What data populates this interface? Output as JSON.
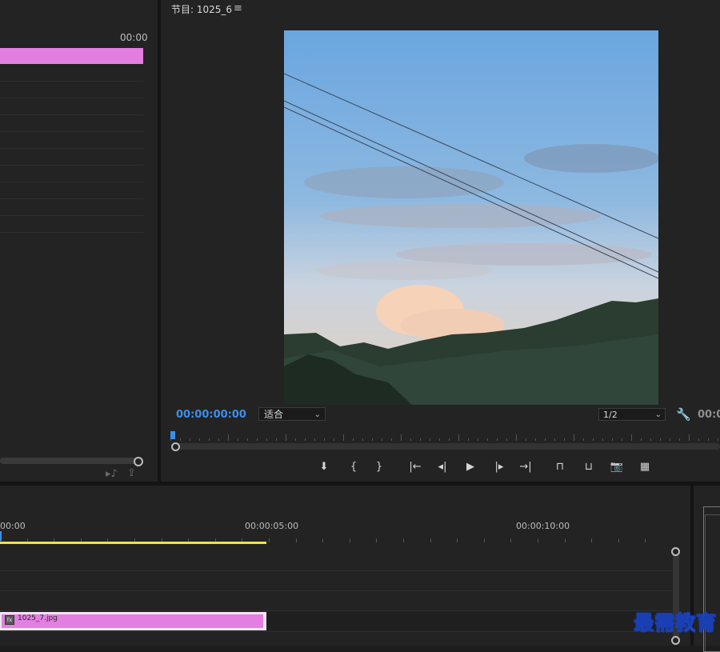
{
  "left_panel": {
    "timecode": "00:00"
  },
  "program_monitor": {
    "title": "节目: 1025_6",
    "menu_icon": "≡",
    "timecode": "00:00:00:00",
    "fit_label": "适合",
    "resolution_label": "1/2",
    "right_timecode": "00:0"
  },
  "transport": [
    {
      "name": "add-marker-button",
      "glyph": "⬇"
    },
    {
      "name": "mark-in-button",
      "glyph": "{"
    },
    {
      "name": "mark-out-button",
      "glyph": "}"
    },
    {
      "name": "go-to-in-button",
      "glyph": "|←"
    },
    {
      "name": "step-back-button",
      "glyph": "◂|"
    },
    {
      "name": "play-button",
      "glyph": "▶"
    },
    {
      "name": "step-forward-button",
      "glyph": "|▸"
    },
    {
      "name": "go-to-out-button",
      "glyph": "→|"
    },
    {
      "name": "lift-button",
      "glyph": "⊓"
    },
    {
      "name": "extract-button",
      "glyph": "⊔"
    },
    {
      "name": "export-frame-button",
      "glyph": "📷"
    },
    {
      "name": "comparison-view-button",
      "glyph": "▦"
    }
  ],
  "timeline": {
    "labels": [
      "00:00",
      "00:00:05:00",
      "00:00:10:00"
    ],
    "clip_name": "1025_7.jpg",
    "clip_fx": "fx"
  },
  "watermark": "最需教育",
  "colors": {
    "accent_blue": "#3d8ee8",
    "clip_pink": "#e37fe0",
    "work_area_yellow": "#f1e13b"
  }
}
